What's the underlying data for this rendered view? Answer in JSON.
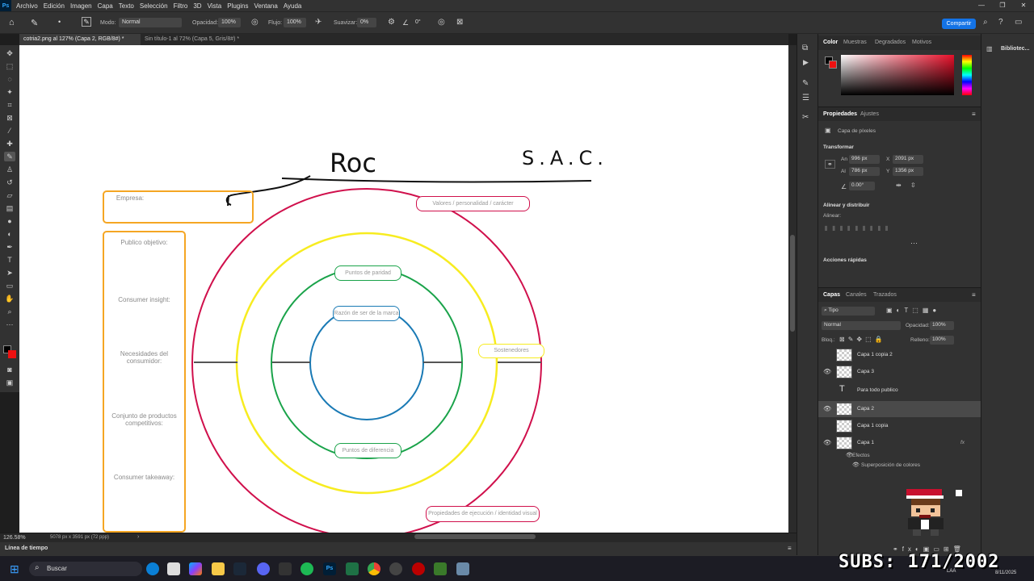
{
  "menu": {
    "items": [
      "Archivo",
      "Edición",
      "Imagen",
      "Capa",
      "Texto",
      "Selección",
      "Filtro",
      "3D",
      "Vista",
      "Plugins",
      "Ventana",
      "Ayuda"
    ]
  },
  "options": {
    "mode_label": "Modo:",
    "mode_value": "Normal",
    "opacity_label": "Opacidad:",
    "opacity_value": "100%",
    "flow_label": "Flujo:",
    "flow_value": "100%",
    "smooth_label": "Suavizar:",
    "smooth_value": "0%",
    "angle_value": "0°",
    "share_label": "Compartir"
  },
  "tabs": [
    {
      "label": "cotria2.png al 127% (Capa 2, RGB/8#) *"
    },
    {
      "label": "Sin título-1 al 72% (Capa 5, Gris/8#) *"
    }
  ],
  "canvas": {
    "handwriting_left": "Roc",
    "handwriting_right": "S.A.C.",
    "empresa": "Empresa:",
    "publico": "Publico objetivo:",
    "insight": "Consumer insight:",
    "necesidades": "Necesidades del consumidor:",
    "conjunto": "Conjunto de productos competitivos:",
    "takeaway": "Consumer takeaway:",
    "valores": "Valores / personalidad / carácter",
    "paridad": "Puntos de paridad",
    "razon": "Razón de ser de la marca",
    "sostenedores": "Sostenedores",
    "diferencia": "Puntos de diferencia",
    "propiedades": "Propiedades de ejecución / identidad visual"
  },
  "status": {
    "zoom": "126.58%",
    "doc": "5078 px x 3591 px (72 ppp)",
    "timeline": "Línea de tiempo"
  },
  "color_panel": {
    "tabs": [
      "Color",
      "Muestras",
      "Degradados",
      "Motivos"
    ]
  },
  "props_panel": {
    "tabs": [
      "Propiedades",
      "Ajustes"
    ],
    "kind": "Capa de píxeles",
    "transform": "Transformar",
    "w_label": "An",
    "w": "996 px",
    "x_label": "X",
    "x": "2091 px",
    "h_label": "Al",
    "h": "786 px",
    "y_label": "Y",
    "y": "1356 px",
    "angle": "0.00°",
    "align": "Alinear y distribuir",
    "align_sub": "Alinear:",
    "quick": "Acciones rápidas"
  },
  "layers_panel": {
    "tabs": [
      "Capas",
      "Canales",
      "Trazados"
    ],
    "filter": "Tipo",
    "blend": "Normal",
    "opacity_label": "Opacidad:",
    "opacity": "100%",
    "lock_label": "Bloq.:",
    "fill_label": "Relleno:",
    "fill": "100%",
    "layers": [
      {
        "name": "Capa 1 copia 2"
      },
      {
        "name": "Capa 3"
      },
      {
        "name": "Para todo publico"
      },
      {
        "name": "Capa 2"
      },
      {
        "name": "Capa 1 copia"
      },
      {
        "name": "Capa 1"
      }
    ],
    "effects": "Efectos",
    "effect_item": "Superposición de colores"
  },
  "right_strip": {
    "label": "Bibliotec..."
  },
  "taskbar": {
    "search": "Buscar",
    "time": "LAA",
    "date": "8/11/2025"
  },
  "overlay": {
    "subs": "SUBS: 171/2002"
  },
  "colors": {
    "accent": "#1473e6",
    "red_ring": "#d0104c",
    "yellow_ring": "#f7ec20",
    "green_ring": "#1aa34a",
    "blue_ring": "#1a7ab5",
    "orange_box": "#f5a623"
  }
}
